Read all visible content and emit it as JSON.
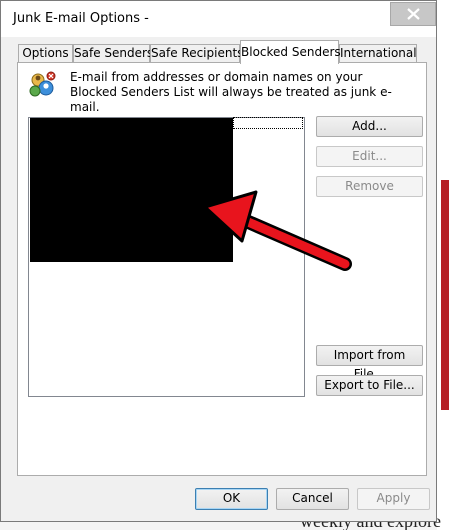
{
  "window": {
    "title": "Junk E-mail Options -"
  },
  "tabs": [
    {
      "label": "Options",
      "active": false
    },
    {
      "label": "Safe Senders",
      "active": false
    },
    {
      "label": "Safe Recipients",
      "active": false
    },
    {
      "label": "Blocked Senders",
      "active": true
    },
    {
      "label": "International",
      "active": false
    }
  ],
  "panel": {
    "info_text": "E-mail from addresses or domain names on your Blocked Senders List will always be treated as junk e-mail.",
    "info_icon": "blocked-senders-icon",
    "list_items": []
  },
  "side_buttons": {
    "add": "Add...",
    "edit": "Edit...",
    "remove": "Remove",
    "import": "Import from File...",
    "export": "Export to File..."
  },
  "footer_buttons": {
    "ok": "OK",
    "cancel": "Cancel",
    "apply": "Apply"
  },
  "background": {
    "partial_text": "weekly and explore"
  },
  "colors": {
    "arrow": "#e8141d",
    "accent_red": "#b51f25",
    "redaction": "#000000"
  }
}
